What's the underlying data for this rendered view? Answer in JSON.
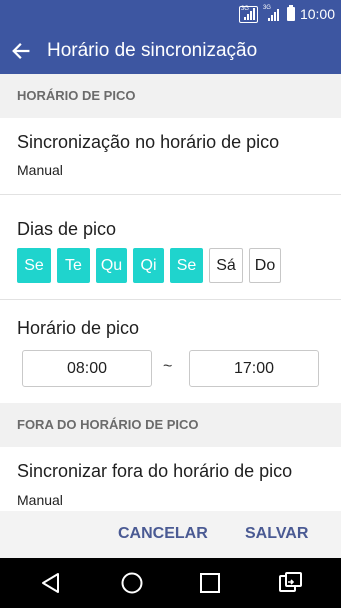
{
  "status_bar": {
    "sim1_label": "3G",
    "sim2_label": "3G",
    "time": "10:00",
    "icons": [
      "signal-sim1-icon",
      "signal-sim2-icon",
      "battery-icon"
    ]
  },
  "app_bar": {
    "back_icon": "back-arrow-icon",
    "title": "Horário de sincronização"
  },
  "peak_section": {
    "header": "HORÁRIO DE PICO",
    "sync_title": "Sincronização no horário de pico",
    "sync_value": "Manual",
    "days_title": "Dias de pico",
    "days": [
      {
        "label": "Se",
        "selected": true
      },
      {
        "label": "Te",
        "selected": true
      },
      {
        "label": "Qu",
        "selected": true
      },
      {
        "label": "Qi",
        "selected": true
      },
      {
        "label": "Se",
        "selected": true
      },
      {
        "label": "Sá",
        "selected": false
      },
      {
        "label": "Do",
        "selected": false
      }
    ],
    "hours_title": "Horário de pico",
    "start_time": "08:00",
    "separator": "~",
    "end_time": "17:00"
  },
  "offpeak_section": {
    "header": "FORA DO HORÁRIO DE PICO",
    "sync_title": "Sincronizar fora do horário de pico",
    "sync_value": "Manual"
  },
  "actions": {
    "cancel": "CANCELAR",
    "save": "SALVAR"
  },
  "nav_bar": {
    "icons": [
      "back-triangle-icon",
      "home-circle-icon",
      "recents-square-icon",
      "dual-window-icon"
    ]
  },
  "colors": {
    "app_bar": "#3d56a1",
    "day_selected": "#1fd4cd",
    "action_text": "#4a5a93",
    "section_bg": "#f1f1f1"
  }
}
